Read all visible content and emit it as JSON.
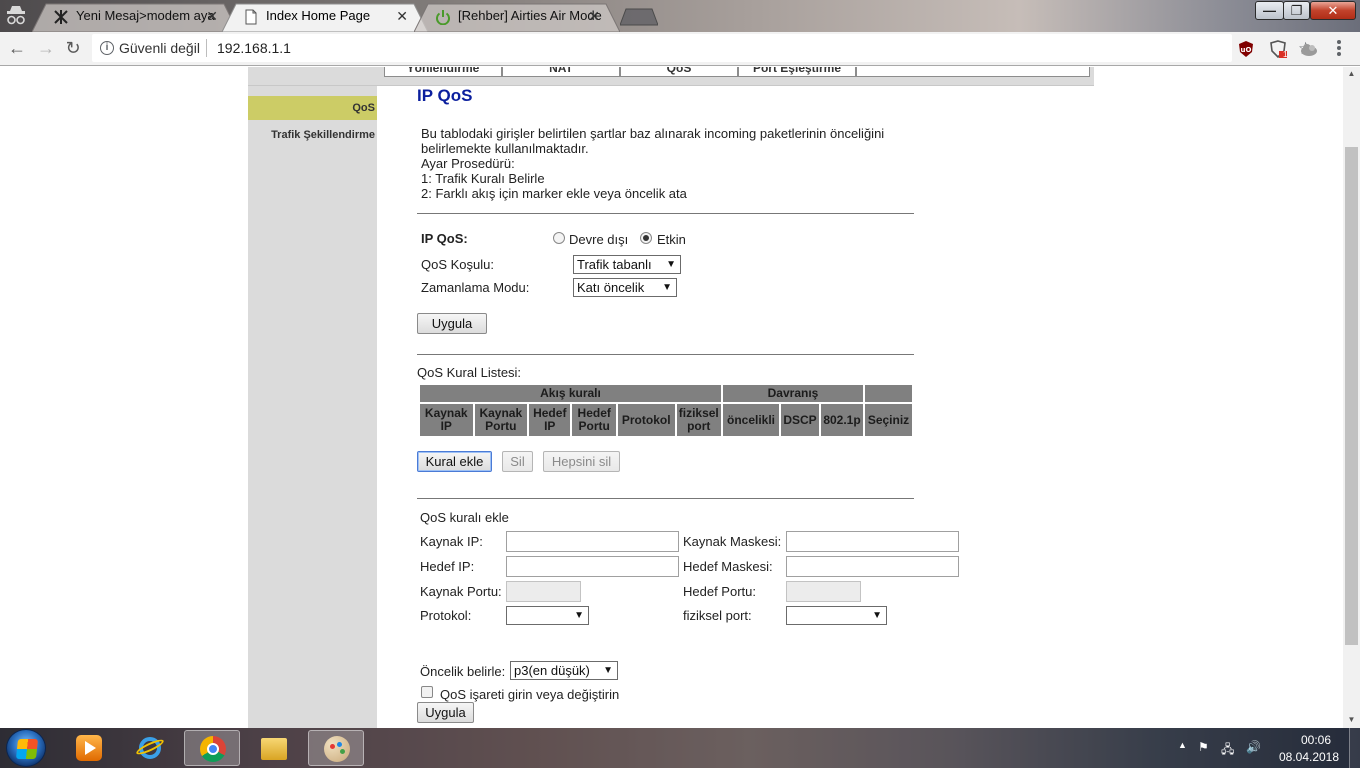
{
  "browser": {
    "tabs": [
      {
        "title": "Yeni Mesaj>modem aya",
        "close": "✕",
        "active": false
      },
      {
        "title": "Index Home Page",
        "close": "✕",
        "active": true
      },
      {
        "title": "[Rehber] Airties Air Mode",
        "close": "✕",
        "active": false
      }
    ],
    "window_buttons": {
      "minimize": "—",
      "maximize": "❐",
      "close": "✕"
    },
    "nav": {
      "back": "←",
      "forward": "→",
      "reload": "↻"
    },
    "security_label": "Güvenli değil",
    "info_glyph": "i",
    "url": "192.168.1.1",
    "star": "☆",
    "extensions": [
      "ublock-origin-icon",
      "brave-shield-icon",
      "cloud-extension-icon"
    ],
    "extension_badge": "1"
  },
  "router": {
    "top_nav": [
      "Yönlendirme",
      "NAT",
      "QoS",
      "Port Eşleştirme"
    ],
    "sidebar": {
      "qos": "QoS",
      "traffic_shaping": "Trafik Şekillendirme"
    },
    "page_title": "IP QoS",
    "description_lines": [
      "Bu tablodaki girişler belirtilen şartlar baz alınarak incoming paketlerinin önceliğini",
      "belirlemekte kullanılmaktadır.",
      "Ayar Prosedürü:",
      "1: Trafik Kuralı Belirle",
      "2: Farklı akış için marker ekle veya öncelik ata"
    ],
    "ip_qos": {
      "label": "IP QoS:",
      "options": [
        "Devre dışı",
        "Etkin"
      ],
      "selected": "Etkin"
    },
    "qos_condition": {
      "label": "QoS Koşulu:",
      "value": "Trafik tabanlı"
    },
    "scheduling_mode": {
      "label": "Zamanlama Modu:",
      "value": "Katı öncelik"
    },
    "apply_button": "Uygula",
    "rule_list": {
      "title": "QoS Kural Listesi:",
      "group_headers": [
        "Akış kuralı",
        "Davranış",
        ""
      ],
      "columns": [
        "Kaynak IP",
        "Kaynak Portu",
        "Hedef IP",
        "Hedef Portu",
        "Protokol",
        "fiziksel port",
        "öncelikli",
        "DSCP",
        "802.1p",
        "Seçiniz"
      ]
    },
    "rule_buttons": {
      "add": "Kural ekle",
      "delete": "Sil",
      "delete_all": "Hepsini sil"
    },
    "add_rule": {
      "title": "QoS kuralı ekle",
      "source_ip": "Kaynak IP:",
      "source_mask": "Kaynak Maskesi:",
      "dest_ip": "Hedef IP:",
      "dest_mask": "Hedef Maskesi:",
      "source_port": "Kaynak Portu:",
      "dest_port": "Hedef Portu:",
      "protocol": "Protokol:",
      "physical_port": "fiziksel port:",
      "values": {
        "source_ip": "",
        "source_mask": "",
        "dest_ip": "",
        "dest_mask": "",
        "source_port": "",
        "dest_port": "",
        "protocol": "",
        "physical_port": ""
      }
    },
    "priority": {
      "label": "Öncelik belirle:",
      "value": "p3(en düşük)"
    },
    "qos_mark_checkbox": {
      "label": "QoS işareti girin veya değiştirin",
      "checked": false
    },
    "apply_button_2": "Uygula"
  },
  "taskbar": {
    "apps": [
      "media-player-icon",
      "internet-explorer-icon",
      "chrome-icon",
      "file-explorer-icon",
      "paint-icon"
    ],
    "active_app": "chrome-icon",
    "tray_up": "▲",
    "time": "00:06",
    "date": "08.04.2018"
  },
  "colors": {
    "title_blue": "#0b1f9e",
    "sidebar_highlight": "#cccc66",
    "panel_grey": "#dbdbdb",
    "table_header_grey": "#808080"
  }
}
